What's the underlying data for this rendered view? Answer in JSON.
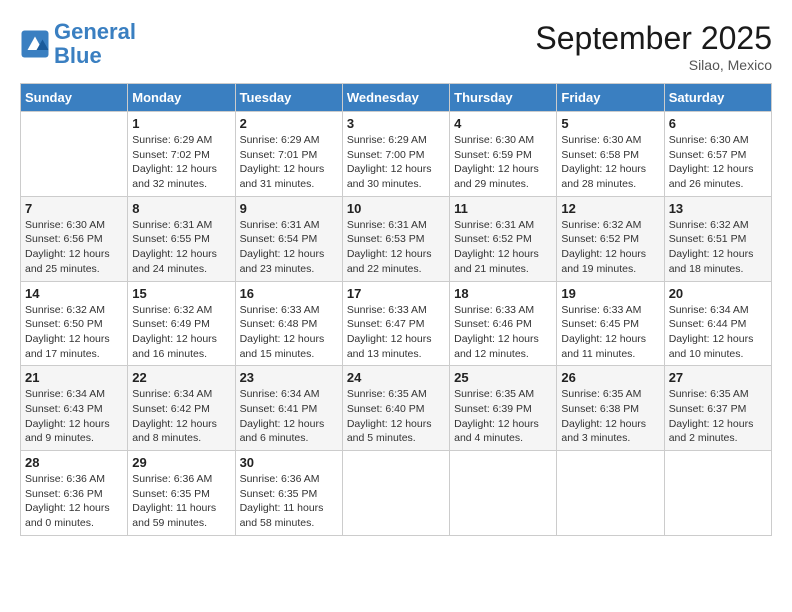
{
  "header": {
    "logo_line1": "General",
    "logo_line2": "Blue",
    "month": "September 2025",
    "location": "Silao, Mexico"
  },
  "days_of_week": [
    "Sunday",
    "Monday",
    "Tuesday",
    "Wednesday",
    "Thursday",
    "Friday",
    "Saturday"
  ],
  "weeks": [
    [
      {
        "day": "",
        "info": ""
      },
      {
        "day": "1",
        "info": "Sunrise: 6:29 AM\nSunset: 7:02 PM\nDaylight: 12 hours\nand 32 minutes."
      },
      {
        "day": "2",
        "info": "Sunrise: 6:29 AM\nSunset: 7:01 PM\nDaylight: 12 hours\nand 31 minutes."
      },
      {
        "day": "3",
        "info": "Sunrise: 6:29 AM\nSunset: 7:00 PM\nDaylight: 12 hours\nand 30 minutes."
      },
      {
        "day": "4",
        "info": "Sunrise: 6:30 AM\nSunset: 6:59 PM\nDaylight: 12 hours\nand 29 minutes."
      },
      {
        "day": "5",
        "info": "Sunrise: 6:30 AM\nSunset: 6:58 PM\nDaylight: 12 hours\nand 28 minutes."
      },
      {
        "day": "6",
        "info": "Sunrise: 6:30 AM\nSunset: 6:57 PM\nDaylight: 12 hours\nand 26 minutes."
      }
    ],
    [
      {
        "day": "7",
        "info": "Sunrise: 6:30 AM\nSunset: 6:56 PM\nDaylight: 12 hours\nand 25 minutes."
      },
      {
        "day": "8",
        "info": "Sunrise: 6:31 AM\nSunset: 6:55 PM\nDaylight: 12 hours\nand 24 minutes."
      },
      {
        "day": "9",
        "info": "Sunrise: 6:31 AM\nSunset: 6:54 PM\nDaylight: 12 hours\nand 23 minutes."
      },
      {
        "day": "10",
        "info": "Sunrise: 6:31 AM\nSunset: 6:53 PM\nDaylight: 12 hours\nand 22 minutes."
      },
      {
        "day": "11",
        "info": "Sunrise: 6:31 AM\nSunset: 6:52 PM\nDaylight: 12 hours\nand 21 minutes."
      },
      {
        "day": "12",
        "info": "Sunrise: 6:32 AM\nSunset: 6:52 PM\nDaylight: 12 hours\nand 19 minutes."
      },
      {
        "day": "13",
        "info": "Sunrise: 6:32 AM\nSunset: 6:51 PM\nDaylight: 12 hours\nand 18 minutes."
      }
    ],
    [
      {
        "day": "14",
        "info": "Sunrise: 6:32 AM\nSunset: 6:50 PM\nDaylight: 12 hours\nand 17 minutes."
      },
      {
        "day": "15",
        "info": "Sunrise: 6:32 AM\nSunset: 6:49 PM\nDaylight: 12 hours\nand 16 minutes."
      },
      {
        "day": "16",
        "info": "Sunrise: 6:33 AM\nSunset: 6:48 PM\nDaylight: 12 hours\nand 15 minutes."
      },
      {
        "day": "17",
        "info": "Sunrise: 6:33 AM\nSunset: 6:47 PM\nDaylight: 12 hours\nand 13 minutes."
      },
      {
        "day": "18",
        "info": "Sunrise: 6:33 AM\nSunset: 6:46 PM\nDaylight: 12 hours\nand 12 minutes."
      },
      {
        "day": "19",
        "info": "Sunrise: 6:33 AM\nSunset: 6:45 PM\nDaylight: 12 hours\nand 11 minutes."
      },
      {
        "day": "20",
        "info": "Sunrise: 6:34 AM\nSunset: 6:44 PM\nDaylight: 12 hours\nand 10 minutes."
      }
    ],
    [
      {
        "day": "21",
        "info": "Sunrise: 6:34 AM\nSunset: 6:43 PM\nDaylight: 12 hours\nand 9 minutes."
      },
      {
        "day": "22",
        "info": "Sunrise: 6:34 AM\nSunset: 6:42 PM\nDaylight: 12 hours\nand 8 minutes."
      },
      {
        "day": "23",
        "info": "Sunrise: 6:34 AM\nSunset: 6:41 PM\nDaylight: 12 hours\nand 6 minutes."
      },
      {
        "day": "24",
        "info": "Sunrise: 6:35 AM\nSunset: 6:40 PM\nDaylight: 12 hours\nand 5 minutes."
      },
      {
        "day": "25",
        "info": "Sunrise: 6:35 AM\nSunset: 6:39 PM\nDaylight: 12 hours\nand 4 minutes."
      },
      {
        "day": "26",
        "info": "Sunrise: 6:35 AM\nSunset: 6:38 PM\nDaylight: 12 hours\nand 3 minutes."
      },
      {
        "day": "27",
        "info": "Sunrise: 6:35 AM\nSunset: 6:37 PM\nDaylight: 12 hours\nand 2 minutes."
      }
    ],
    [
      {
        "day": "28",
        "info": "Sunrise: 6:36 AM\nSunset: 6:36 PM\nDaylight: 12 hours\nand 0 minutes."
      },
      {
        "day": "29",
        "info": "Sunrise: 6:36 AM\nSunset: 6:35 PM\nDaylight: 11 hours\nand 59 minutes."
      },
      {
        "day": "30",
        "info": "Sunrise: 6:36 AM\nSunset: 6:35 PM\nDaylight: 11 hours\nand 58 minutes."
      },
      {
        "day": "",
        "info": ""
      },
      {
        "day": "",
        "info": ""
      },
      {
        "day": "",
        "info": ""
      },
      {
        "day": "",
        "info": ""
      }
    ]
  ]
}
